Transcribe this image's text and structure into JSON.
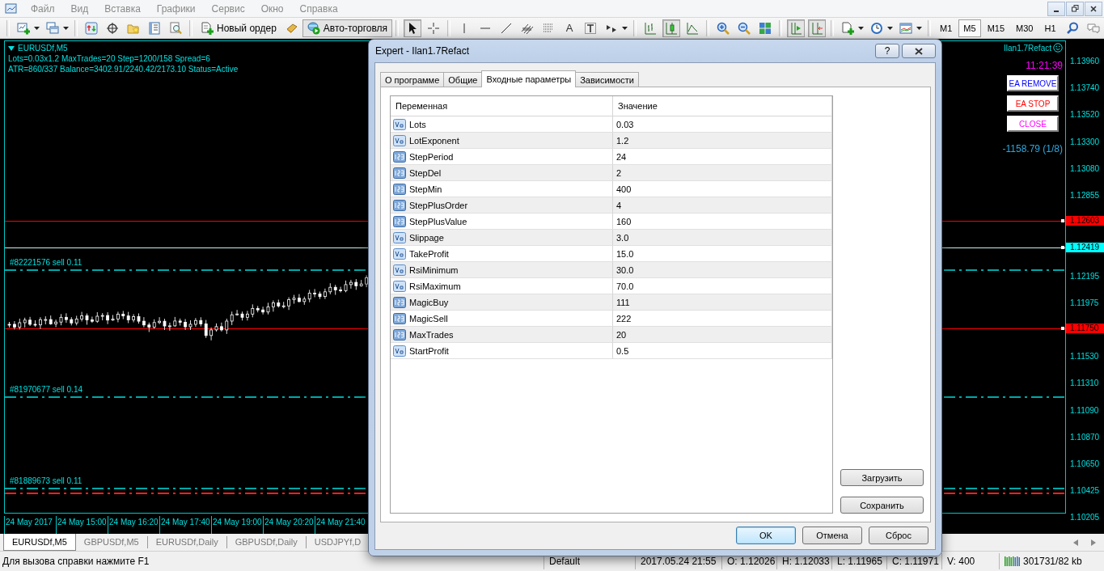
{
  "menu": {
    "items": [
      "Файл",
      "Вид",
      "Вставка",
      "Графики",
      "Сервис",
      "Окно",
      "Справка"
    ]
  },
  "toolbar": {
    "items": [
      {
        "kind": "separator"
      },
      {
        "kind": "icon",
        "pressed": false
      },
      {
        "kind": "icon",
        "pressed": false
      },
      {
        "kind": "separator"
      },
      {
        "kind": "icon",
        "pressed": false
      },
      {
        "kind": "icon",
        "pressed": false
      },
      {
        "kind": "icon",
        "pressed": false
      },
      {
        "kind": "icon",
        "pressed": false
      },
      {
        "kind": "icon",
        "pressed": false
      },
      {
        "kind": "separator"
      },
      {
        "kind": "button",
        "label": "Новый ордер",
        "pressed": false
      },
      {
        "kind": "icon",
        "pressed": false
      },
      {
        "kind": "button",
        "label": "Авто-торговля",
        "pressed": true
      },
      {
        "kind": "separator"
      },
      {
        "kind": "icon",
        "pressed": true
      },
      {
        "kind": "icon",
        "pressed": false
      },
      {
        "kind": "separator"
      },
      {
        "kind": "icon",
        "pressed": false
      },
      {
        "kind": "icon",
        "pressed": false
      },
      {
        "kind": "icon",
        "pressed": false
      },
      {
        "kind": "icon",
        "pressed": false
      },
      {
        "kind": "icon",
        "pressed": false
      },
      {
        "kind": "glyph",
        "label": "A",
        "pressed": false
      },
      {
        "kind": "icon",
        "pressed": false
      },
      {
        "kind": "icon",
        "pressed": false
      },
      {
        "kind": "separator"
      },
      {
        "kind": "icon",
        "pressed": false
      },
      {
        "kind": "icon",
        "pressed": true
      },
      {
        "kind": "icon",
        "pressed": false
      },
      {
        "kind": "separator"
      },
      {
        "kind": "icon",
        "pressed": false
      },
      {
        "kind": "icon",
        "pressed": false
      },
      {
        "kind": "icon",
        "pressed": false
      },
      {
        "kind": "separator"
      },
      {
        "kind": "icon",
        "pressed": true
      },
      {
        "kind": "icon",
        "pressed": true
      },
      {
        "kind": "separator"
      },
      {
        "kind": "icon",
        "pressed": false
      },
      {
        "kind": "icon",
        "pressed": false
      },
      {
        "kind": "icon",
        "pressed": false
      },
      {
        "kind": "separator"
      },
      {
        "kind": "timeframe",
        "label": "M1",
        "selected": false
      },
      {
        "kind": "timeframe",
        "label": "M5",
        "selected": true
      },
      {
        "kind": "timeframe",
        "label": "M15",
        "selected": false
      },
      {
        "kind": "timeframe",
        "label": "M30",
        "selected": false
      },
      {
        "kind": "timeframe",
        "label": "H1",
        "selected": false
      },
      {
        "kind": "spacer"
      },
      {
        "kind": "icon",
        "pressed": false
      },
      {
        "kind": "icon",
        "pressed": false
      }
    ]
  },
  "chart": {
    "symbol": "EURUSDf,M5",
    "info_lines": [
      "Lots=0.03x1.2 MaxTrades=20 Step=1200/158 Spread=6",
      "ATR=860/337 Balance=3402.91/2240.42/2173.10 Status=Active"
    ],
    "ea_panel": {
      "name": "Ilan1.7Refact",
      "time": "11:21:39",
      "buttons": [
        {
          "label": "EA REMOVE",
          "color": "#0000ff"
        },
        {
          "label": "EA STOP",
          "color": "#ff0000"
        },
        {
          "label": "CLOSE",
          "color": "#ff00ff"
        }
      ],
      "profit": "-1158.79 (1/8)"
    },
    "orders": [
      {
        "label": "#82221576 sell 0.11"
      },
      {
        "label": "#81970677 sell 0.14"
      },
      {
        "label": "#81889673 sell 0.11"
      }
    ],
    "price_axis": [
      {
        "label": "1.13960"
      },
      {
        "label": "1.13740"
      },
      {
        "label": "1.13520"
      },
      {
        "label": "1.13300"
      },
      {
        "label": "1.13080"
      },
      {
        "label": "1.12855"
      },
      {
        "label": "1.12603",
        "color": "#ff0000"
      },
      {
        "label": "1.12419",
        "color": "#00ffff"
      },
      {
        "label": "1.12195"
      },
      {
        "label": "1.11975"
      },
      {
        "label": "1.11750",
        "color": "#ff0000"
      },
      {
        "label": "1.11530"
      },
      {
        "label": "1.11310"
      },
      {
        "label": "1.11090"
      },
      {
        "label": "1.10870"
      },
      {
        "label": "1.10650"
      },
      {
        "label": "1.10425"
      },
      {
        "label": "1.10205"
      }
    ],
    "time_axis": [
      "24 May 2017",
      "24 May 15:00",
      "24 May 16:20",
      "24 May 17:40",
      "24 May 19:00",
      "24 May 20:20",
      "24 May 21:40"
    ]
  },
  "chart_tabs": [
    {
      "label": "EURUSDf,M5",
      "selected": true
    },
    {
      "label": "GBPUSDf,M5",
      "selected": false
    },
    {
      "label": "EURUSDf,Daily",
      "selected": false
    },
    {
      "label": "GBPUSDf,Daily",
      "selected": false
    },
    {
      "label": "USDJPYf,D",
      "selected": false
    }
  ],
  "status_bar": {
    "help": "Для вызова справки нажмите F1",
    "profile": "Default",
    "datetime": "2017.05.24 21:55",
    "open": "O: 1.12026",
    "high": "H: 1.12033",
    "low": "L: 1.11965",
    "close": "C: 1.11971",
    "volume": "V: 400",
    "traffic": "301731/82 kb"
  },
  "dialog": {
    "title": "Expert - Ilan1.7Refact",
    "help": "?",
    "tabs": [
      {
        "label": "О программе",
        "selected": false
      },
      {
        "label": "Общие",
        "selected": false
      },
      {
        "label": "Входные параметры",
        "selected": true
      },
      {
        "label": "Зависимости",
        "selected": false
      }
    ],
    "table": {
      "columns": [
        "Переменная",
        "Значение"
      ],
      "rows": [
        {
          "kind": "double",
          "name": "Lots",
          "value": "0.03"
        },
        {
          "kind": "double",
          "name": "LotExponent",
          "value": "1.2"
        },
        {
          "kind": "int",
          "name": "StepPeriod",
          "value": "24"
        },
        {
          "kind": "int",
          "name": "StepDel",
          "value": "2"
        },
        {
          "kind": "int",
          "name": "StepMin",
          "value": "400"
        },
        {
          "kind": "int",
          "name": "StepPlusOrder",
          "value": "4"
        },
        {
          "kind": "int",
          "name": "StepPlusValue",
          "value": "160"
        },
        {
          "kind": "double",
          "name": "Slippage",
          "value": "3.0"
        },
        {
          "kind": "double",
          "name": "TakeProfit",
          "value": "15.0"
        },
        {
          "kind": "double",
          "name": "RsiMinimum",
          "value": "30.0"
        },
        {
          "kind": "double",
          "name": "RsiMaximum",
          "value": "70.0"
        },
        {
          "kind": "int",
          "name": "MagicBuy",
          "value": "111"
        },
        {
          "kind": "int",
          "name": "MagicSell",
          "value": "222"
        },
        {
          "kind": "int",
          "name": "MaxTrades",
          "value": "20"
        },
        {
          "kind": "double",
          "name": "StartProfit",
          "value": "0.5"
        }
      ]
    },
    "side_buttons": [
      "Загрузить",
      "Сохранить"
    ],
    "buttons": [
      {
        "label": "OK",
        "default": true
      },
      {
        "label": "Отмена",
        "default": false
      },
      {
        "label": "Сброс",
        "default": false
      }
    ]
  }
}
